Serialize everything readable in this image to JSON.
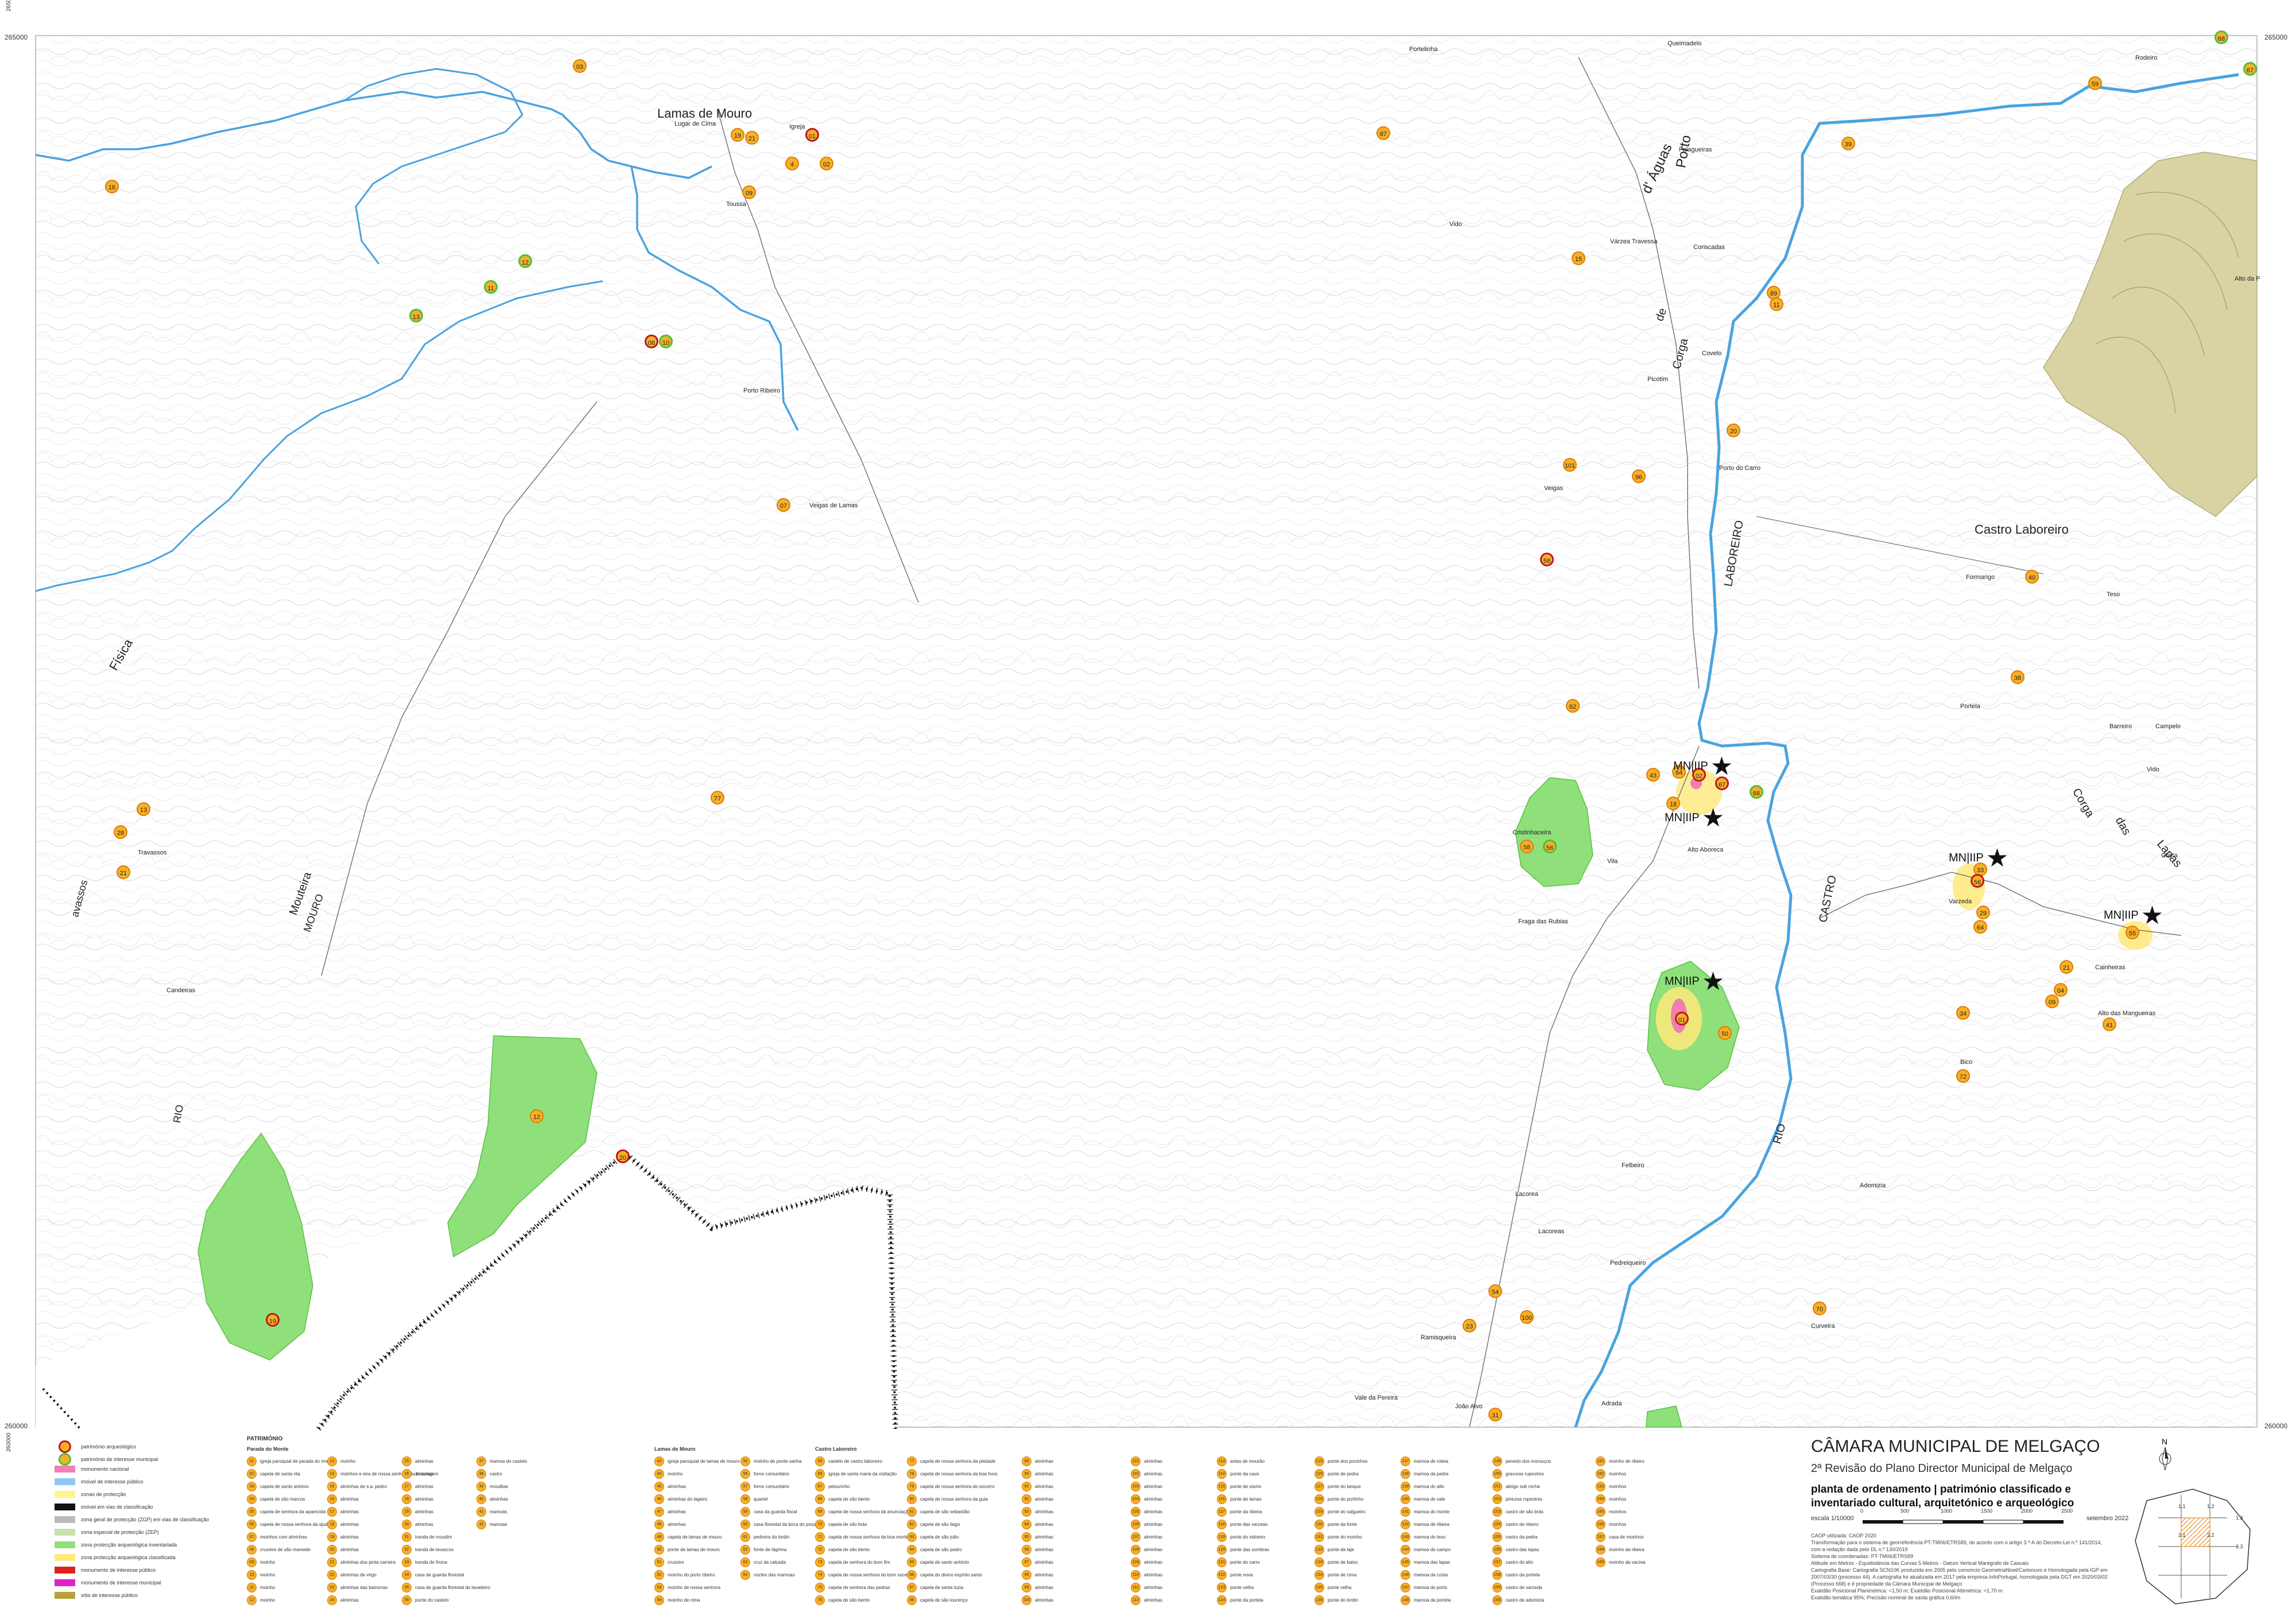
{
  "places": [
    {
      "text": "Lamas de Mouro",
      "size": 22
    },
    {
      "text": "Castro Laboreiro",
      "size": 22
    },
    {
      "text": "Lugar de Cima",
      "size": 11
    },
    {
      "text": "Igreja",
      "size": 11
    },
    {
      "text": "Toussa",
      "size": 11
    },
    {
      "text": "Porto Ribeiro",
      "size": 11
    },
    {
      "text": "Veigas de Lamas",
      "size": 11
    },
    {
      "text": "Portelinha",
      "size": 11
    },
    {
      "text": "Queimadelo",
      "size": 11
    },
    {
      "text": "Rodeiro",
      "size": 11
    },
    {
      "text": "Falagueiras",
      "size": 11
    },
    {
      "text": "Coriscadas",
      "size": 11
    },
    {
      "text": "Várzea Travessa",
      "size": 11
    },
    {
      "text": "Vido",
      "size": 11
    },
    {
      "text": "Covelo",
      "size": 11
    },
    {
      "text": "Picotim",
      "size": 11
    },
    {
      "text": "Porto do Carro",
      "size": 11
    },
    {
      "text": "Veigas",
      "size": 11
    },
    {
      "text": "Formarigo",
      "size": 11
    },
    {
      "text": "Teso",
      "size": 11
    },
    {
      "text": "Portela",
      "size": 11
    },
    {
      "text": "Barreiro",
      "size": 11
    },
    {
      "text": "Campelo",
      "size": 11
    },
    {
      "text": "Vido",
      "size": 11
    },
    {
      "text": "Costa",
      "size": 11
    },
    {
      "text": "Alto Aboreca",
      "size": 11
    },
    {
      "text": "Varzeda",
      "size": 11
    },
    {
      "text": "Cainheiras",
      "size": 11
    },
    {
      "text": "Alto das Mangueiras",
      "size": 11
    },
    {
      "text": "Bico",
      "size": 11
    },
    {
      "text": "Adomizia",
      "size": 11
    },
    {
      "text": "Curveira",
      "size": 11
    },
    {
      "text": "Cristinhaceira",
      "size": 11
    },
    {
      "text": "Vila",
      "size": 11
    },
    {
      "text": "Fraga das Rubias",
      "size": 11
    },
    {
      "text": "Felbeiro",
      "size": 11
    },
    {
      "text": "Lacorea",
      "size": 11
    },
    {
      "text": "Lacoreas",
      "size": 11
    },
    {
      "text": "Pedreiqueiro",
      "size": 11
    },
    {
      "text": "Ramisqueira",
      "size": 11
    },
    {
      "text": "Vale da Pereira",
      "size": 11
    },
    {
      "text": "João Alvo",
      "size": 11
    },
    {
      "text": "Adrada",
      "size": 11
    },
    {
      "text": "Candeiras",
      "size": 11
    },
    {
      "text": "Travassos",
      "size": 11
    },
    {
      "text": "Alto da P",
      "size": 11
    }
  ],
  "rotated_labels": [
    {
      "text": "Porto",
      "size": 24
    },
    {
      "text": "d' Águas",
      "size": 24
    },
    {
      "text": "de",
      "size": 20
    },
    {
      "text": "Corga",
      "size": 20
    },
    {
      "text": "LABOREIRO",
      "size": 20
    },
    {
      "text": "CASTRO",
      "size": 20
    },
    {
      "text": "RIO",
      "size": 20
    },
    {
      "text": "Corga",
      "size": 20
    },
    {
      "text": "das",
      "size": 20
    },
    {
      "text": "Lapas",
      "size": 20
    },
    {
      "text": "Física",
      "size": 22
    },
    {
      "text": "avassos",
      "size": 18
    },
    {
      "text": "Mouteira",
      "size": 20
    },
    {
      "text": "MOURO",
      "size": 18
    },
    {
      "text": "RIO",
      "size": 18
    }
  ],
  "markers": [
    {
      "n": "03",
      "t": "o"
    },
    {
      "n": "16",
      "t": "o"
    },
    {
      "n": "19",
      "t": "o"
    },
    {
      "n": "21",
      "t": "o"
    },
    {
      "n": "01",
      "t": "red"
    },
    {
      "n": "4",
      "t": "o"
    },
    {
      "n": "02",
      "t": "o"
    },
    {
      "n": "09",
      "t": "o"
    },
    {
      "n": "12",
      "t": "green"
    },
    {
      "n": "11",
      "t": "green"
    },
    {
      "n": "13",
      "t": "green"
    },
    {
      "n": "06",
      "t": "red"
    },
    {
      "n": "10",
      "t": "green"
    },
    {
      "n": "07",
      "t": "o"
    },
    {
      "n": "87",
      "t": "o"
    },
    {
      "n": "39",
      "t": "o"
    },
    {
      "n": "59",
      "t": "o"
    },
    {
      "n": "67",
      "t": "green"
    },
    {
      "n": "68",
      "t": "green"
    },
    {
      "n": "15",
      "t": "o"
    },
    {
      "n": "89",
      "t": "o"
    },
    {
      "n": "11",
      "t": "o"
    },
    {
      "n": "20",
      "t": "o"
    },
    {
      "n": "96",
      "t": "o"
    },
    {
      "n": "101",
      "t": "o"
    },
    {
      "n": "58",
      "t": "red"
    },
    {
      "n": "62",
      "t": "o"
    },
    {
      "n": "18",
      "t": "o"
    },
    {
      "n": "56",
      "t": "green"
    },
    {
      "n": "43",
      "t": "o"
    },
    {
      "n": "64",
      "t": "o"
    },
    {
      "n": "02",
      "t": "red"
    },
    {
      "n": "67",
      "t": "red"
    },
    {
      "n": "66",
      "t": "green"
    },
    {
      "n": "01",
      "t": "red"
    },
    {
      "n": "50",
      "t": "o"
    },
    {
      "n": "33",
      "t": "o"
    },
    {
      "n": "56",
      "t": "red"
    },
    {
      "n": "29",
      "t": "o"
    },
    {
      "n": "64",
      "t": "o"
    },
    {
      "n": "55",
      "t": "o"
    },
    {
      "n": "21",
      "t": "o"
    },
    {
      "n": "09",
      "t": "o"
    },
    {
      "n": "04",
      "t": "o"
    },
    {
      "n": "34",
      "t": "o"
    },
    {
      "n": "41",
      "t": "o"
    },
    {
      "n": "72",
      "t": "o"
    },
    {
      "n": "40",
      "t": "o"
    },
    {
      "n": "38",
      "t": "o"
    },
    {
      "n": "13",
      "t": "o"
    },
    {
      "n": "28",
      "t": "o"
    },
    {
      "n": "21",
      "t": "o"
    },
    {
      "n": "12",
      "t": "o"
    },
    {
      "n": "19",
      "t": "red"
    },
    {
      "n": "20",
      "t": "red"
    },
    {
      "n": "54",
      "t": "o"
    },
    {
      "n": "100",
      "t": "o"
    },
    {
      "n": "23",
      "t": "o"
    },
    {
      "n": "70",
      "t": "o"
    },
    {
      "n": "31",
      "t": "o"
    },
    {
      "n": "77",
      "t": "o"
    },
    {
      "n": "58",
      "t": "o"
    }
  ],
  "monuments": [
    {
      "text": "MN|IIP"
    },
    {
      "text": "MN|IIP"
    },
    {
      "text": "MN|IIP"
    },
    {
      "text": "MN|IIP"
    },
    {
      "text": "MN|IIP"
    }
  ],
  "coords": [
    "265000",
    "260000",
    "265000",
    "260000",
    "265000",
    "260000"
  ],
  "legend": {
    "symbols": [
      "património arqueológico",
      "património de interesse municipal",
      "monumento nacional",
      "imóvel de interesse público",
      "zonas de protecção",
      "imóvel em vias de classificação",
      "zona geral de protecção (ZGP) em vias de classificação",
      "zona especial de protecção (ZEP)",
      "zona protecção arqueológica inventariada",
      "zona protecção arqueológica classificada",
      "monumento de interesse público",
      "monumento de interesse municipal",
      "sítio de interesse público"
    ],
    "patr_title": "PATRIMÓNIO",
    "columns": [
      {
        "title": "Parada do Monte",
        "items": [
          "igreja paroquial de parada do monte",
          "capela de santa rita",
          "capela de santo antónio",
          "capela de são marcos",
          "capela de senhora da aparecida",
          "capela de nossa senhora da ajuda",
          "moinhos com alminhas",
          "cruzeiro de são mamede",
          "moinho",
          "moinho",
          "moinho",
          "moinho"
        ]
      },
      {
        "title": "",
        "items": [
          "moinho",
          "moinhos e eira de nossa senhora da boaviagem",
          "alminhas de s.a. pedro",
          "alminhas",
          "alminhas",
          "alminhas",
          "alminhas",
          "alminhas",
          "alminhas dos pinta carreira",
          "alminhas de virgo",
          "alminhas das bamonas",
          "alminhas"
        ]
      },
      {
        "title": "",
        "items": [
          "alminhas",
          "alminhas",
          "alminhas",
          "alminhas",
          "alminhas",
          "alminhas",
          "tranda de moudim",
          "tranda de lavascos",
          "tranda de friona",
          "casa de guarda florestal",
          "casa de guarda florestal do lavadeiro",
          "ponte do castelo"
        ]
      },
      {
        "title": "",
        "items": [
          "mamoa do castelo",
          "castro",
          "mouditas",
          "alminhas",
          "mamoas",
          "mamoas"
        ]
      },
      {
        "title": "Lamas de Mouro",
        "items": [
          "igreja paroquial de lamas de mouro",
          "moinho",
          "alminhas",
          "alminhas do lageiro",
          "alminhas",
          "alminhas",
          "capela de lamas de mouro",
          "ponte de lamas de mouro",
          "cruzeiro",
          "moinho do porto ribeiro",
          "moinho de nossa senhora",
          "moinho de cima"
        ]
      },
      {
        "title": "",
        "items": [
          "moinho de ponte sanha",
          "forno comunitário",
          "forno comunitário",
          "quartel",
          "casa da guarda fiscal",
          "casa florestal da boca do possedo",
          "pedreira do lordin",
          "fonte de lágrima",
          "cruz da calçada",
          "núcleo das mamoas"
        ]
      },
      {
        "title": "Castro Laboreiro",
        "items": [
          "castelo de castro laboreiro",
          "igreja de santa maria da visitação",
          "pelourinho",
          "capela de são bento",
          "capela de nossa senhora da anunciação",
          "capela de são brás",
          "capela de nossa senhora da boa morte",
          "capela de são bento",
          "capela de senhora do bom fim",
          "capela de nossa senhora do bom sucesso",
          "capela de senhora das pedras",
          "capela de são bento"
        ]
      },
      {
        "title": "",
        "items": [
          "capela de nossa senhora da piedade",
          "capela de nossa senhora da boa hora",
          "capela de nossa senhora do socorro",
          "capela de nossa senhora da guia",
          "capela de são sebastião",
          "capela de são tiago",
          "capela de são joão",
          "capela de são pedro",
          "capela de santo antónio",
          "capela do divino espírito santo",
          "capela de santa luzia",
          "capela de são lourenço"
        ]
      },
      {
        "title": "",
        "items": [
          "alminhas",
          "alminhas",
          "alminhas",
          "alminhas",
          "alminhas",
          "alminhas",
          "alminhas",
          "alminhas",
          "alminhas",
          "alminhas",
          "alminhas",
          "alminhas"
        ]
      },
      {
        "title": "",
        "items": [
          "alminhas",
          "alminhas",
          "alminhas",
          "alminhas",
          "alminhas",
          "alminhas",
          "alminhas",
          "alminhas",
          "alminhas",
          "alminhas",
          "alminhas",
          "alminhas"
        ]
      },
      {
        "title": "",
        "items": [
          "antas de mourão",
          "ponte da cava",
          "ponte de sismo",
          "ponte de lamas",
          "ponte da ribeira",
          "ponte das varzeas",
          "ponte do vidoeiro",
          "ponte das sombras",
          "ponte do carro",
          "ponte nova",
          "ponte velha",
          "ponte da portela"
        ]
      },
      {
        "title": "",
        "items": [
          "ponte dos pocinhos",
          "ponte de pedra",
          "ponte do tanque",
          "ponte do portinho",
          "ponte do salgueiro",
          "ponte da fonte",
          "ponte do moinho",
          "ponte da laje",
          "ponte de baixo",
          "ponte de cima",
          "ponte velha",
          "ponte do lordin"
        ]
      },
      {
        "title": "",
        "items": [
          "mamoa de roteia",
          "mamoa da pedra",
          "mamoa do alto",
          "mamoa do vale",
          "mamoa do monte",
          "mamoa de ribeira",
          "mamoa do teso",
          "mamoa do campo",
          "mamoa das lapas",
          "mamoa da costa",
          "mamoa do porto",
          "mamoa da portela"
        ]
      },
      {
        "title": "",
        "items": [
          "penedo dos morouços",
          "gravuras rupestres",
          "abrigo sob rocha",
          "pinturas rupestres",
          "castro de são brás",
          "castro de ribeiro",
          "castro da pedra",
          "castro das lapas",
          "castro do alto",
          "castro da portela",
          "castro de varzeda",
          "castro de adomizia"
        ]
      },
      {
        "title": "",
        "items": [
          "moinho de ribeiro",
          "moinhos",
          "moinhos",
          "moinhos",
          "moinhos",
          "moinhos",
          "casa de moinhos",
          "moinho da ribeira",
          "moinho da varzea"
        ]
      }
    ]
  },
  "title_block": {
    "org": "CÂMARA MUNICIPAL DE MELGAÇO",
    "sub": "2ª Revisão do Plano Director Municipal de Melgaço",
    "plan": "planta de ordenamento | património classificado e inventariado cultural, arquitetónico e arqueológico",
    "scale_label": "escala 1/10000",
    "date": "setembro 2022",
    "scale_ticks": [
      "0",
      "500",
      "1000",
      "1500",
      "2000",
      "2500"
    ],
    "north": "N",
    "notes": [
      "CAOP utilizada: CAOP 2020",
      "Transformação para o sistema de georreferência PT-TM06/ETRS89, de acordo com o artigo 3.º-A do Decreto-Lei n.º 141/2014, com a redação dada pelo DL n.º 130/2019",
      "Sistema de coordenadas: PT-TM06/ETRS89",
      "Altitude em Metros - Equidistância das Curvas 5 Metros - Datum Vertical Marégrafo de Cascais",
      "Cartografia Base: Cartografia SCN10K produzida em 2005 pelo consórcio GeometriaNivel/Cartonuvo e Homologada pela IGP em 2007/03/30 (processo 44). A cartografia foi atualizada em 2017 pela empresa InfoPortugal, homologada pela DGT em 2020/03/02 (Processo 668) e é propriedade da Câmara Municipal de Melgaço",
      "Exatidão Posicional Planimétrica: <1,50 m; Exatidão Posicional Altimétrica: <1,70 m",
      "Exatidão temática 95%; Precisão nominal de saída gráfica 0,60m"
    ],
    "inset_labels": [
      "1.1",
      "1.2",
      "1.3",
      "2.1",
      "2.2",
      "2.3"
    ]
  }
}
